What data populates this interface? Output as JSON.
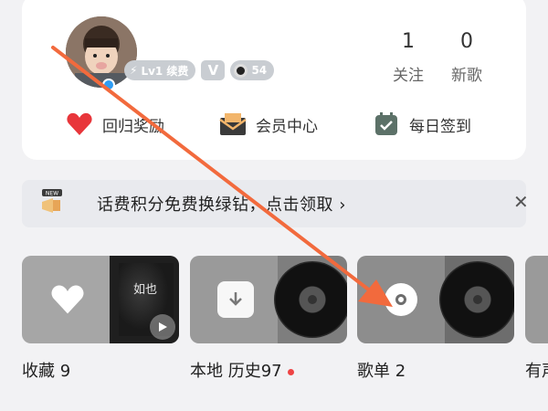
{
  "profile": {
    "level_badge": "Lv1 续费",
    "vip_badge": "V",
    "svip_badge": "54",
    "stats": [
      {
        "value": "1",
        "label": "关注"
      },
      {
        "value": "0",
        "label": "新歌"
      }
    ],
    "quick_actions": [
      {
        "label": "回归奖励",
        "icon": "heart-icon"
      },
      {
        "label": "会员中心",
        "icon": "envelope-icon"
      },
      {
        "label": "每日签到",
        "icon": "calendar-check-icon"
      }
    ]
  },
  "banner": {
    "text": "话费积分免费换绿钻，点击领取 ›",
    "icon": "megaphone-new-icon",
    "close_icon": "close-icon"
  },
  "tiles": [
    {
      "label": "收藏 9",
      "icon": "heart-icon",
      "cover_text": "如也"
    },
    {
      "label": "本地 历史97",
      "icon": "download-icon",
      "has_dot": true
    },
    {
      "label": "歌单 2",
      "icon": "disc-icon"
    },
    {
      "label": "有声",
      "icon": "audio-icon"
    }
  ],
  "colors": {
    "accent_red": "#ee4444",
    "arrow": "#f26a3d",
    "card_bg": "#ffffff",
    "page_bg": "#f2f2f4"
  }
}
